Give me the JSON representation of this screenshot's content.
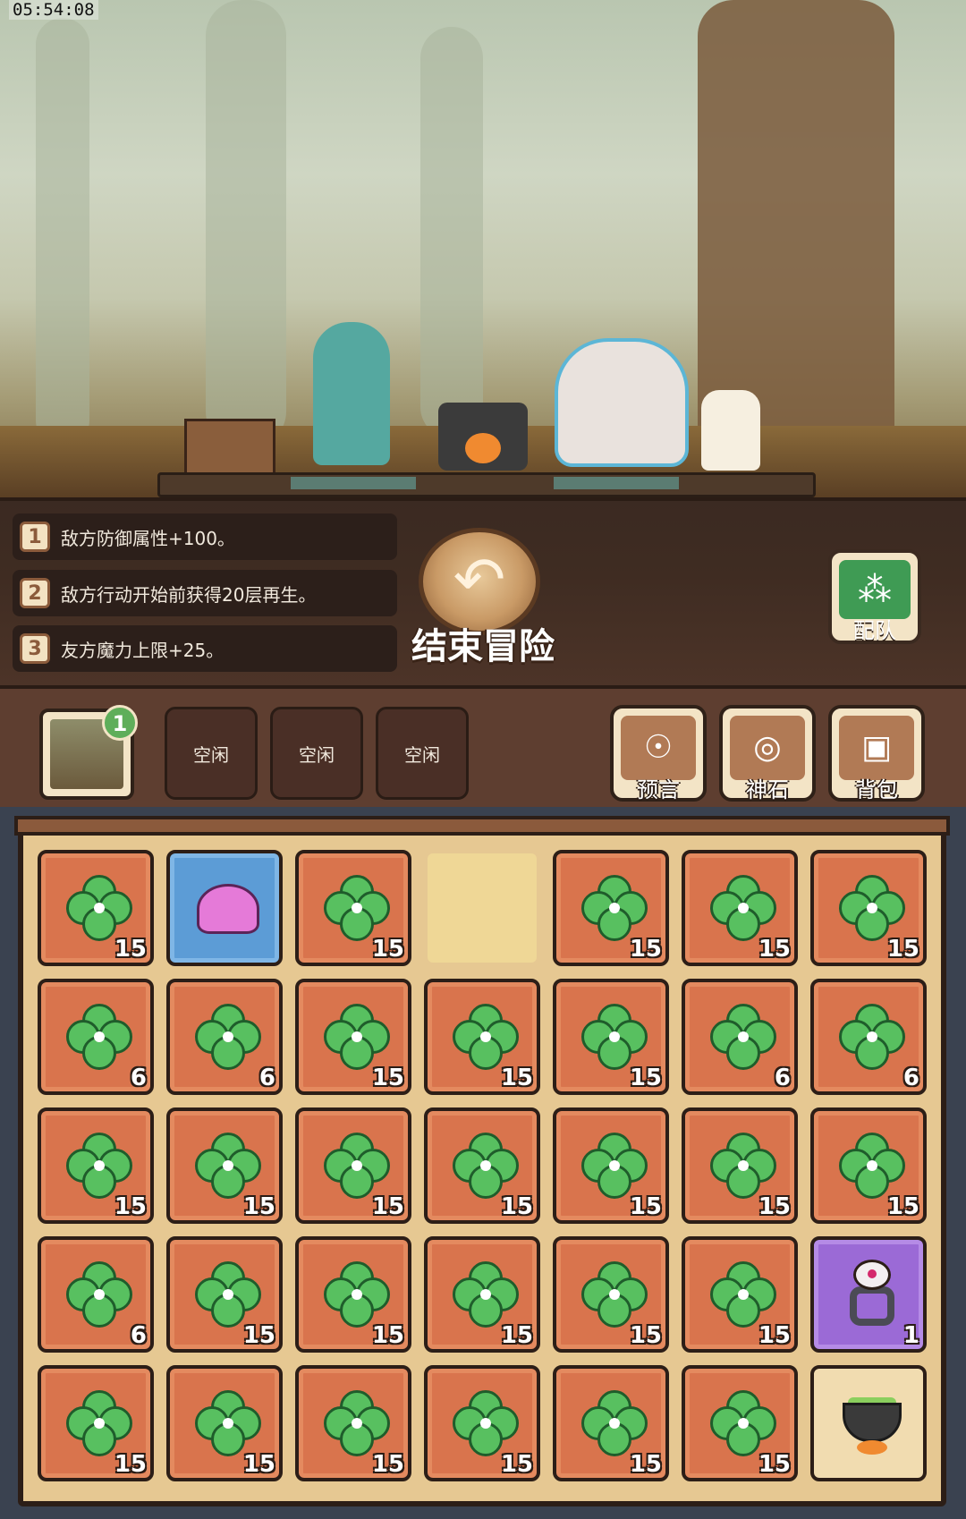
{
  "status": {
    "clock": "05:54:08"
  },
  "effects": [
    {
      "num": "1",
      "text": "敌方防御属性+100。"
    },
    {
      "num": "2",
      "text": "敌方行动开始前获得20层再生。"
    },
    {
      "num": "3",
      "text": "友方魔力上限+25。"
    }
  ],
  "actions": {
    "end_adventure": "结束冒险",
    "team": "配队"
  },
  "level": {
    "badge": "1"
  },
  "idle_slots": [
    "空闲",
    "空闲",
    "空闲"
  ],
  "tools": [
    "预言",
    "神石",
    "背包"
  ],
  "inventory": [
    {
      "type": "clover",
      "color": "orange",
      "count": "15"
    },
    {
      "type": "slime",
      "color": "blue",
      "count": ""
    },
    {
      "type": "clover",
      "color": "orange",
      "count": "15"
    },
    {
      "type": "empty",
      "color": "empty",
      "count": ""
    },
    {
      "type": "clover",
      "color": "orange",
      "count": "15"
    },
    {
      "type": "clover",
      "color": "orange",
      "count": "15"
    },
    {
      "type": "clover",
      "color": "orange",
      "count": "15"
    },
    {
      "type": "clover",
      "color": "orange",
      "count": "6"
    },
    {
      "type": "clover",
      "color": "orange",
      "count": "6"
    },
    {
      "type": "clover",
      "color": "orange",
      "count": "15"
    },
    {
      "type": "clover",
      "color": "orange",
      "count": "15"
    },
    {
      "type": "clover",
      "color": "orange",
      "count": "15"
    },
    {
      "type": "clover",
      "color": "orange",
      "count": "6"
    },
    {
      "type": "clover",
      "color": "orange",
      "count": "6"
    },
    {
      "type": "clover",
      "color": "orange",
      "count": "15"
    },
    {
      "type": "clover",
      "color": "orange",
      "count": "15"
    },
    {
      "type": "clover",
      "color": "orange",
      "count": "15"
    },
    {
      "type": "clover",
      "color": "orange",
      "count": "15"
    },
    {
      "type": "clover",
      "color": "orange",
      "count": "15"
    },
    {
      "type": "clover",
      "color": "orange",
      "count": "15"
    },
    {
      "type": "clover",
      "color": "orange",
      "count": "15"
    },
    {
      "type": "clover",
      "color": "orange",
      "count": "6"
    },
    {
      "type": "clover",
      "color": "orange",
      "count": "15"
    },
    {
      "type": "clover",
      "color": "orange",
      "count": "15"
    },
    {
      "type": "clover",
      "color": "orange",
      "count": "15"
    },
    {
      "type": "clover",
      "color": "orange",
      "count": "15"
    },
    {
      "type": "clover",
      "color": "orange",
      "count": "15"
    },
    {
      "type": "ring",
      "color": "purple",
      "count": "1"
    },
    {
      "type": "clover",
      "color": "orange",
      "count": "15"
    },
    {
      "type": "clover",
      "color": "orange",
      "count": "15"
    },
    {
      "type": "clover",
      "color": "orange",
      "count": "15"
    },
    {
      "type": "clover",
      "color": "orange",
      "count": "15"
    },
    {
      "type": "clover",
      "color": "orange",
      "count": "15"
    },
    {
      "type": "clover",
      "color": "orange",
      "count": "15"
    },
    {
      "type": "pot",
      "color": "pot",
      "count": ""
    }
  ],
  "colors": {
    "clover": "#58c060",
    "orange_slot": "#d9744d",
    "blue_slot": "#5c9cd6",
    "purple_slot": "#9b6ad6"
  }
}
